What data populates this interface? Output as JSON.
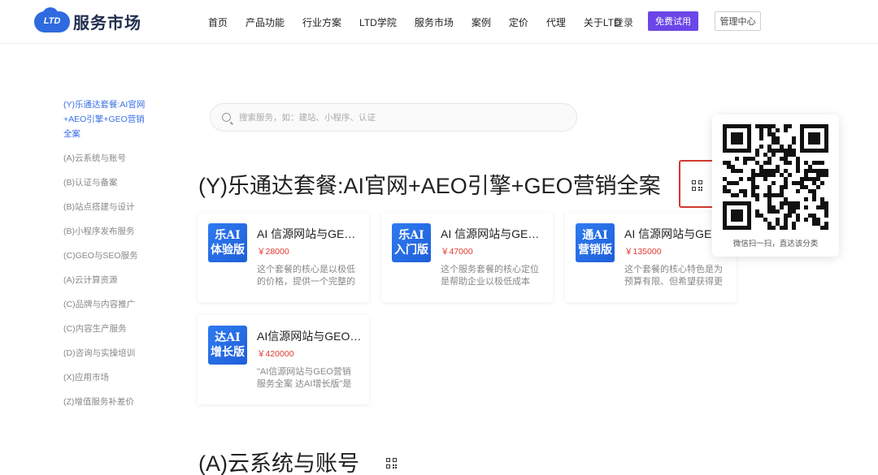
{
  "header": {
    "logo_mark": "LTD",
    "logo_title": "服务市场",
    "nav": [
      "首页",
      "产品功能",
      "行业方案",
      "LTD学院",
      "服务市场",
      "案例",
      "定价",
      "代理",
      "关于LTD"
    ],
    "login": "登录",
    "trial_button": "免费试用",
    "admin_button": "管理中心"
  },
  "sidebar": {
    "items": [
      "(Y)乐通达套餐:AI官网+AEO引擎+GEO营销全案",
      "(A)云系统与账号",
      "(B)认证与备案",
      "(B)站点搭建与设计",
      "(B)小程序发布服务",
      "(C)GEO与SEO服务",
      "(A)云计算资源",
      "(C)品牌与内容推广",
      "(C)内容生产服务",
      "(D)咨询与实操培训",
      "(X)应用市场",
      "(Z)增值服务补差价"
    ]
  },
  "search": {
    "placeholder": "搜索服务，如：建站、小程序、认证"
  },
  "sections": [
    {
      "title": "(Y)乐通达套餐:AI官网+AEO引擎+GEO营销全案",
      "cards": [
        {
          "thumb_line1": "乐AI",
          "thumb_line2": "体验版",
          "title": "AI 信源网站与GEO营销服务全案",
          "price": "￥28000",
          "desc": "这个套餐的核心是以极低的价格，提供一个完整的入门体验"
        },
        {
          "thumb_line1": "乐AI",
          "thumb_line2": "入门版",
          "title": "AI 信源网站与GEO营销服务全案",
          "price": "￥47000",
          "desc": "这个服务套餐的核心定位是帮助企业以极低成本"
        },
        {
          "thumb_line1": "通AI",
          "thumb_line2": "营销版",
          "title": "AI 信源网站与GEO营销",
          "price": "￥135000",
          "desc": "这个套餐的核心特色是为预算有限、但希望获得更多"
        },
        {
          "thumb_line1": "达AI",
          "thumb_line2": "增长版",
          "title": "AI信源网站与GEO营销服务全案",
          "price": "￥420000",
          "desc": "\"AI信源网站与GEO营销服务全案 达AI增长版\"是一套完整方案"
        }
      ]
    },
    {
      "title": "(A)云系统与账号"
    }
  ],
  "qr_popup": {
    "caption": "微信扫一扫，直达该分类"
  },
  "colors": {
    "accent": "#6b46e8",
    "link": "#3a6fe6",
    "price": "#e03a2f",
    "highlight": "#d23a2e",
    "thumb": "#2e7bf0"
  },
  "icons": [
    "search-icon",
    "qr-code-icon"
  ]
}
